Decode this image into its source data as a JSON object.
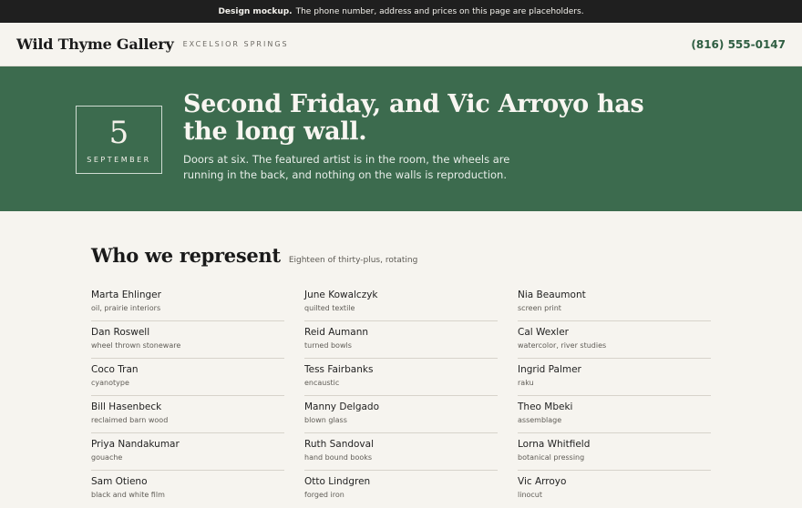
{
  "notice": {
    "bold": "Design mockup.",
    "text": "The phone number, address and prices on this page are placeholders."
  },
  "header": {
    "logo": "Wild Thyme Gallery",
    "location": "EXCELSIOR SPRINGS",
    "phone": "(816) 555-0147"
  },
  "hero": {
    "date_day": "5",
    "date_month": "SEPTEMBER",
    "title": "Second Friday, and Vic Arroyo has the long wall.",
    "description": "Doors at six. The featured artist is in the room, the wheels are running in the back, and nothing on the walls is reproduction."
  },
  "represent": {
    "title": "Who we represent",
    "subtitle": "Eighteen of thirty-plus, rotating",
    "columns": [
      [
        {
          "name": "Marta Ehlinger",
          "medium": "oil, prairie interiors"
        },
        {
          "name": "Dan Roswell",
          "medium": "wheel thrown stoneware"
        },
        {
          "name": "Coco Tran",
          "medium": "cyanotype"
        },
        {
          "name": "Bill Hasenbeck",
          "medium": "reclaimed barn wood"
        },
        {
          "name": "Priya Nandakumar",
          "medium": "gouache"
        },
        {
          "name": "Sam Otieno",
          "medium": "black and white film"
        }
      ],
      [
        {
          "name": "June Kowalczyk",
          "medium": "quilted textile"
        },
        {
          "name": "Reid Aumann",
          "medium": "turned bowls"
        },
        {
          "name": "Tess Fairbanks",
          "medium": "encaustic"
        },
        {
          "name": "Manny Delgado",
          "medium": "blown glass"
        },
        {
          "name": "Ruth Sandoval",
          "medium": "hand bound books"
        },
        {
          "name": "Otto Lindgren",
          "medium": "forged iron"
        }
      ],
      [
        {
          "name": "Nia Beaumont",
          "medium": "screen print"
        },
        {
          "name": "Cal Wexler",
          "medium": "watercolor, river studies"
        },
        {
          "name": "Ingrid Palmer",
          "medium": "raku"
        },
        {
          "name": "Theo Mbeki",
          "medium": "assemblage"
        },
        {
          "name": "Lorna Whitfield",
          "medium": "botanical pressing"
        },
        {
          "name": "Vic Arroyo",
          "medium": "linocut"
        }
      ]
    ]
  }
}
